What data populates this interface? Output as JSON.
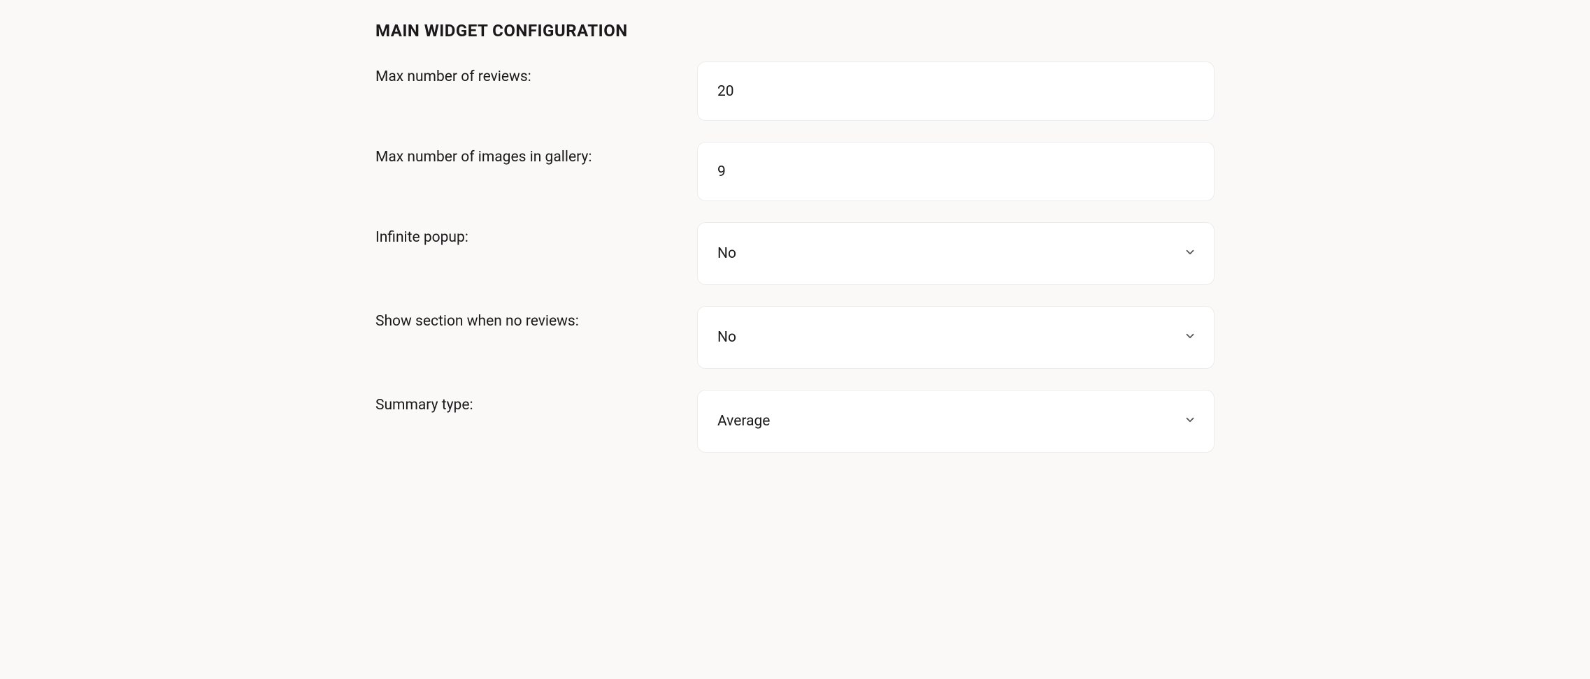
{
  "section": {
    "title": "MAIN WIDGET CONFIGURATION"
  },
  "fields": {
    "maxReviews": {
      "label": "Max number of reviews:",
      "value": "20"
    },
    "maxImages": {
      "label": "Max number of images in gallery:",
      "value": "9"
    },
    "infinitePopup": {
      "label": "Infinite popup:",
      "value": "No"
    },
    "showSectionNoReviews": {
      "label": "Show section when no reviews:",
      "value": "No"
    },
    "summaryType": {
      "label": "Summary type:",
      "value": "Average"
    }
  }
}
